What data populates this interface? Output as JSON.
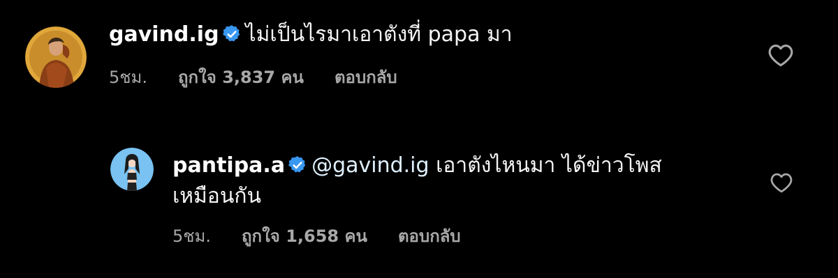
{
  "comments": [
    {
      "username": "gavind.ig",
      "text": "ไม่เป็นไรมาเอาตังที่ papa มา",
      "time": "5ชม.",
      "likes": "ถูกใจ 3,837 คน",
      "reply": "ตอบกลับ",
      "icons": {
        "verified": "verified-badge-icon",
        "like": "heart-outline-icon"
      }
    },
    {
      "username": "pantipa.a",
      "mention": "@gavind.ig",
      "text_line1": "เอาตังไหนมา ได้ข่าวโพส",
      "text_line2": "เหมือนกัน",
      "time": "5ชม.",
      "likes": "ถูกใจ 1,658 คน",
      "reply": "ตอบกลับ",
      "icons": {
        "verified": "verified-badge-icon",
        "like": "heart-outline-icon"
      }
    }
  ],
  "colors": {
    "background": "#000000",
    "verified": "#3897f0",
    "meta_text": "#a8a8a8",
    "avatar1_bg": "#e0a73a",
    "avatar2_bg": "#79c2f2"
  }
}
